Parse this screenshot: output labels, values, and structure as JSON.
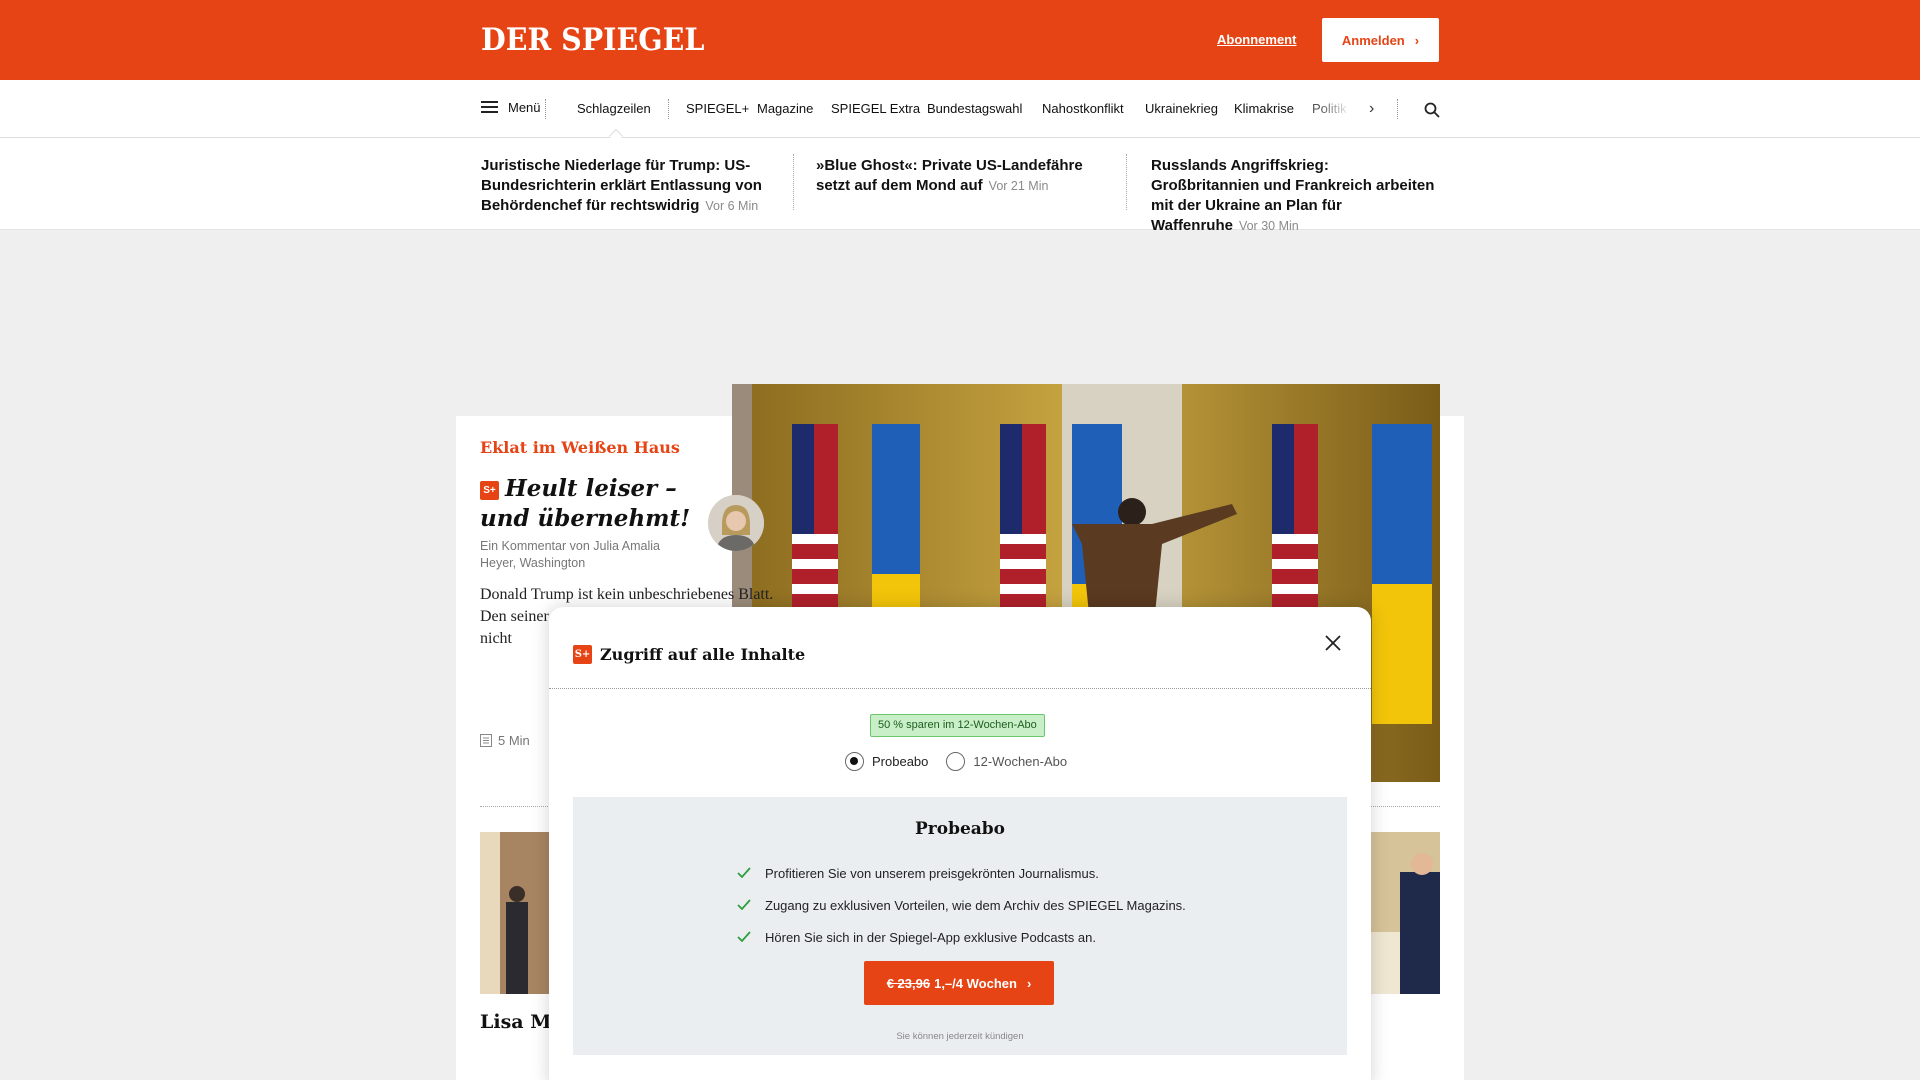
{
  "header": {
    "logo": "DER SPIEGEL",
    "subscription_link": "Abonnement",
    "login_button": "Anmelden",
    "brand_color": "#e64415"
  },
  "nav": {
    "menu_label": "Menü",
    "items": [
      "Schlagzeilen",
      "SPIEGEL+",
      "Magazine",
      "SPIEGEL Extra",
      "Bundestagswahl",
      "Nahostkonflikt",
      "Ukrainekrieg",
      "Klimakrise",
      "Politik"
    ],
    "active": "Schlagzeilen"
  },
  "teasers": [
    {
      "title": "Juristische Niederlage für Trump: US-Bundesrichterin erklärt Entlassung von Behördenchef für rechtswidrig",
      "time": "Vor 6 Min"
    },
    {
      "title": "»Blue Ghost«: Private US-Landefähre setzt auf dem Mond auf",
      "time": "Vor 21 Min"
    },
    {
      "title": "Russlands Angriffskrieg: Großbritannien und Frankreich arbeiten mit der Ukraine an Plan für Waffenruhe",
      "time": "Vor 30 Min"
    }
  ],
  "article": {
    "kicker": "Eklat im Weißen Haus",
    "badge": "S+",
    "headline": "Heult leiser – und übernehmt!",
    "byline": "Ein Kommentar von Julia Amalia Heyer, Washington",
    "teaser_text": "Donald Trump ist kein unbeschriebenes Blatt. Den seiner Rüc empört da und wie e aber nicht",
    "read_time": "5 Min"
  },
  "second_article": {
    "headline": "Lisa Mu gegen T"
  },
  "modal": {
    "title": "Zugriff auf alle Inhalte",
    "save_badge": "50 % sparen im 12-Wochen-Abo",
    "options": [
      "Probeabo",
      "12-Wochen-Abo"
    ],
    "selected": "Probeabo",
    "plan_title": "Probeabo",
    "benefits": [
      "Profitieren Sie von unserem preisgekrönten Journalismus.",
      "Zugang zu exklusiven Vorteilen, wie dem Archiv des SPIEGEL Magazins.",
      "Hören Sie sich in der Spiegel-App exklusive Podcasts an."
    ],
    "cta_old_price": "€ 23,96",
    "cta_new_price": "1,–/4 Wochen",
    "cancel_note": "Sie können jederzeit kündigen"
  }
}
